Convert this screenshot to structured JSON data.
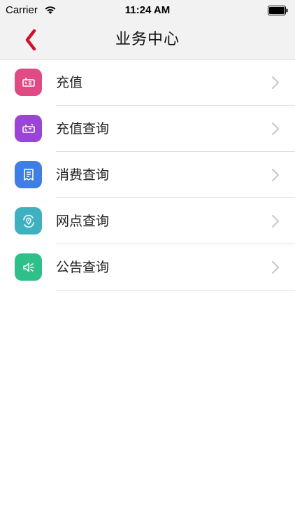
{
  "status_bar": {
    "carrier": "Carrier",
    "time": "11:24 AM"
  },
  "nav": {
    "title": "业务中心",
    "back_icon": "chevron-left-icon",
    "accent_color": "#d0102b"
  },
  "items": [
    {
      "label": "充值",
      "icon": "recharge-icon",
      "color": "#e04a86"
    },
    {
      "label": "充值查询",
      "icon": "recharge-query-icon",
      "color": "#9b45d6"
    },
    {
      "label": "消费查询",
      "icon": "receipt-icon",
      "color": "#3f7ee6"
    },
    {
      "label": "网点查询",
      "icon": "location-icon",
      "color": "#3fb0bf"
    },
    {
      "label": "公告查询",
      "icon": "speaker-icon",
      "color": "#2fc08a"
    }
  ]
}
